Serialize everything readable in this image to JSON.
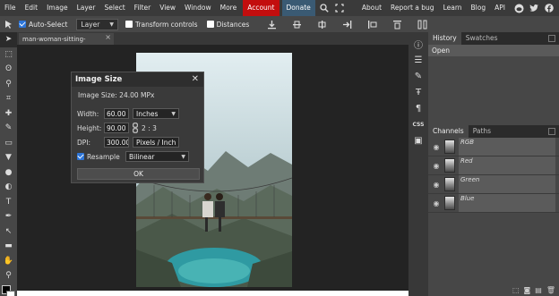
{
  "menubar": {
    "items": [
      "File",
      "Edit",
      "Image",
      "Layer",
      "Select",
      "Filter",
      "View",
      "Window",
      "More"
    ],
    "account": "Account",
    "donate": "Donate",
    "right_items": [
      "About",
      "Report a bug",
      "Learn",
      "Blog",
      "API"
    ]
  },
  "options": {
    "auto_select": "Auto-Select",
    "layer_select": "Layer",
    "transform_controls": "Transform controls",
    "distances": "Distances"
  },
  "document": {
    "tab_title": "man-woman-sitting-"
  },
  "dialog": {
    "title": "Image Size",
    "info": "Image Size: 24.00 MPx",
    "width_label": "Width:",
    "width_value": "60.00",
    "width_unit": "Inches",
    "height_label": "Height:",
    "height_value": "90.00",
    "ratio": "2 : 3",
    "dpi_label": "DPI:",
    "dpi_value": "300.000",
    "dpi_unit": "Pixels / Inch",
    "resample_label": "Resample",
    "resample_method": "Bilinear",
    "ok": "OK"
  },
  "history": {
    "tabs": [
      "History",
      "Swatches"
    ],
    "items": [
      "Open"
    ]
  },
  "channels": {
    "tabs": [
      "Channels",
      "Paths"
    ],
    "items": [
      "RGB",
      "Red",
      "Green",
      "Blue"
    ]
  },
  "colors": {
    "accent": "#2d75d8",
    "account": "#c30e0e",
    "panel": "#474747",
    "background": "#232323"
  }
}
